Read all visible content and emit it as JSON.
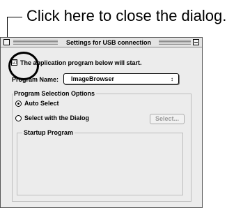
{
  "callout": {
    "text": "Click here to close the dialog."
  },
  "dialog": {
    "title": "Settings for USB connection",
    "checkbox_mark": "☑",
    "start_checkbox_label": "The application program below will start.",
    "program_name_label": "Program Name:",
    "program_name_value": "ImageBrowser",
    "program_name_arrows": "↕",
    "selection_group_label": "Program Selection Options",
    "options": [
      {
        "label": "Auto Select",
        "selected": true
      },
      {
        "label": "Select with the Dialog",
        "selected": false
      }
    ],
    "select_button_label": "Select...",
    "startup_program_label": "Startup Program"
  }
}
